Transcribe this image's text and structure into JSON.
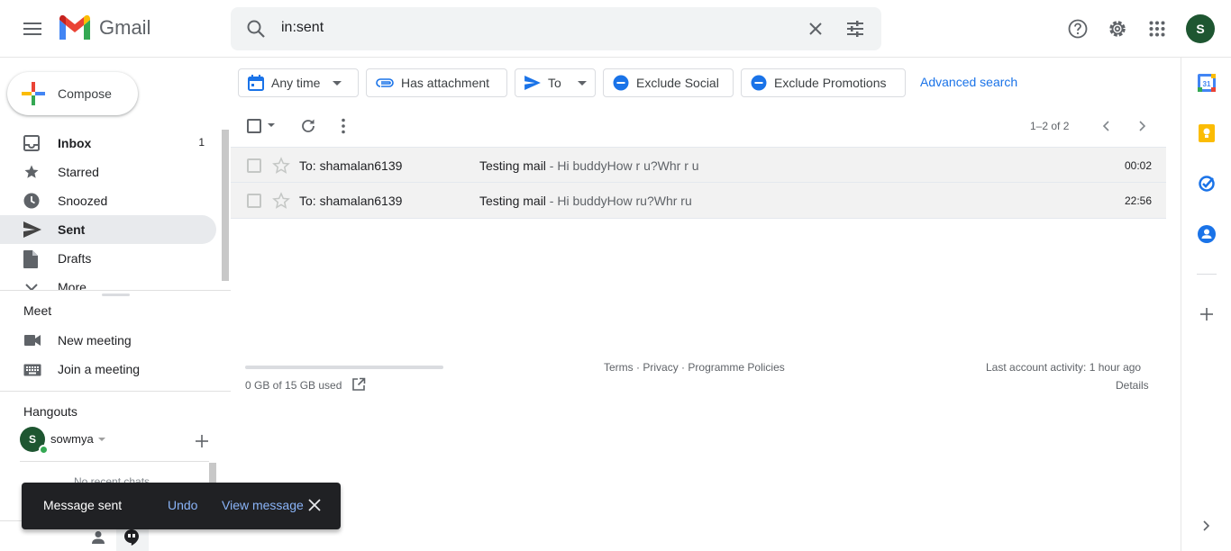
{
  "header": {
    "app_name": "Gmail",
    "search_value": "in:sent",
    "avatar_initial": "S",
    "icons": [
      "main-menu-icon",
      "search-icon",
      "clear-search-icon",
      "search-options-icon",
      "help-icon",
      "settings-icon",
      "apps-icon"
    ]
  },
  "nav": {
    "compose_label": "Compose",
    "items": [
      {
        "label": "Inbox",
        "count": "1",
        "icon": "inbox-icon"
      },
      {
        "label": "Starred",
        "count": "",
        "icon": "star-icon"
      },
      {
        "label": "Snoozed",
        "count": "",
        "icon": "clock-icon"
      },
      {
        "label": "Sent",
        "count": "",
        "icon": "send-icon"
      },
      {
        "label": "Drafts",
        "count": "",
        "icon": "draft-icon"
      },
      {
        "label": "More",
        "count": "",
        "icon": "chevron-down-icon"
      }
    ]
  },
  "meet": {
    "title": "Meet",
    "new_meeting": "New meeting",
    "join_meeting": "Join a meeting"
  },
  "hangouts": {
    "title": "Hangouts",
    "user_name": "sowmya",
    "user_initial": "S",
    "no_chats": "No recent chats"
  },
  "filters": {
    "any_time": "Any time",
    "has_attachment": "Has attachment",
    "to": "To",
    "exclude_social": "Exclude Social",
    "exclude_promotions": "Exclude Promotions",
    "advanced_search": "Advanced search"
  },
  "toolbar": {
    "pager": "1–2 of 2"
  },
  "messages": [
    {
      "to": "To: shamalan6139",
      "subject": "Testing mail",
      "snippet": " - Hi buddyHow r u?Whr r u",
      "time": "00:02"
    },
    {
      "to": "To: shamalan6139",
      "subject": "Testing mail",
      "snippet": " - Hi buddyHow ru?Whr ru",
      "time": "22:56"
    }
  ],
  "footer": {
    "storage": "0 GB of 15 GB used",
    "storage_fraction": 0.0,
    "terms": "Terms",
    "privacy": "Privacy",
    "policies": "Programme Policies",
    "last_activity": "Last account activity: 1 hour ago",
    "details": "Details"
  },
  "snackbar": {
    "message": "Message sent",
    "undo": "Undo",
    "view": "View message"
  },
  "colors": {
    "accent": "#1a73e8",
    "active_nav": "#e8eaed",
    "avatar": "#1e5631",
    "snackbar": "#202124",
    "snackbar_link": "#8ab4f8"
  }
}
